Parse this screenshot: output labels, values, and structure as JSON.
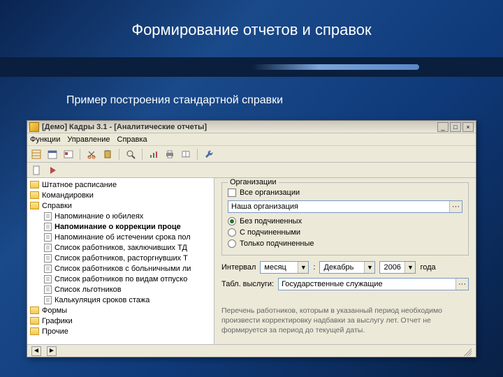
{
  "slide": {
    "title": "Формирование отчетов и справок",
    "subtitle": "Пример построения стандартной справки"
  },
  "window": {
    "title": "[Демо] Кадры 3.1 - [Аналитические отчеты]"
  },
  "menu": {
    "functions": "Функции",
    "management": "Управление",
    "help": "Справка"
  },
  "tree": {
    "items": [
      {
        "type": "folder",
        "level": 0,
        "label": "Штатное расписание"
      },
      {
        "type": "folder",
        "level": 0,
        "label": "Командировки"
      },
      {
        "type": "folder",
        "level": 0,
        "label": "Справки"
      },
      {
        "type": "doc",
        "level": 1,
        "label": "Напоминание о юбилеях"
      },
      {
        "type": "doc",
        "level": 1,
        "label": "Напоминание о коррекции проце",
        "selected": true
      },
      {
        "type": "doc",
        "level": 1,
        "label": "Напоминание об истечении срока пол"
      },
      {
        "type": "doc",
        "level": 1,
        "label": "Список работников, заключивших ТД"
      },
      {
        "type": "doc",
        "level": 1,
        "label": "Список работников, расторгнувших Т"
      },
      {
        "type": "doc",
        "level": 1,
        "label": "Список работников с больничными ли"
      },
      {
        "type": "doc",
        "level": 1,
        "label": "Список работников по видам отпуско"
      },
      {
        "type": "doc",
        "level": 1,
        "label": "Список льготников"
      },
      {
        "type": "doc",
        "level": 1,
        "label": "Калькуляция сроков стажа"
      },
      {
        "type": "folder",
        "level": 0,
        "label": "Формы"
      },
      {
        "type": "folder",
        "level": 0,
        "label": "Графики"
      },
      {
        "type": "folder",
        "level": 0,
        "label": "Прочие"
      }
    ]
  },
  "form": {
    "org_group": "Организации",
    "all_orgs": "Все организации",
    "org_value": "Наша организация",
    "r1": "Без подчиненных",
    "r2": "С подчиненными",
    "r3": "Только подчиненные",
    "interval_label": "Интервал",
    "interval_value": "месяц",
    "sep": ":",
    "month_value": "Декабрь",
    "year_value": "2006",
    "year_suffix": "года",
    "table_label": "Табл. выслуги:",
    "table_value": "Государственные служащие",
    "hint": "Перечень работников, которым в указанный период необходимо произвести корректировку надбавки за выслугу лет. Отчет не формируется за период до текущей даты."
  },
  "icons": {
    "min": "_",
    "max": "□",
    "close": "×",
    "dots": "···",
    "dd": "▼",
    "left": "◄",
    "right": "►"
  }
}
